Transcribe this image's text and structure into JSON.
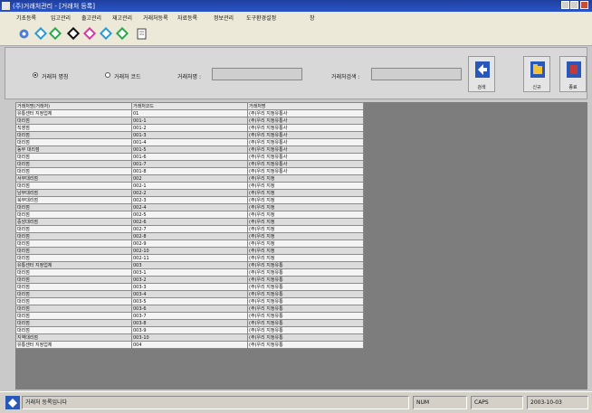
{
  "window": {
    "title": "(주)거래처관리 - [거래처 등록]",
    "controls": [
      "minimize-icon",
      "maximize-icon",
      "close-icon"
    ]
  },
  "menu": {
    "items": [
      "기초등록",
      "입고관리",
      "출고관리",
      "재고관리",
      "거래처등록",
      "자료등록",
      "정보관리",
      "도구환경설정",
      "창"
    ]
  },
  "toolbar": {
    "icons": [
      "app-icon",
      "nav-first-icon",
      "nav-prev-icon",
      "nav-stop-icon",
      "nav-refresh-icon",
      "nav-next-icon",
      "nav-last-icon",
      "document-icon"
    ]
  },
  "search_panel": {
    "radio_name": "거래처 명칭",
    "radio_code": "거래처 코드",
    "name_label": "거래처명 :",
    "name_value": "",
    "addr_label": "거래처검색 :",
    "addr_value": "",
    "btn_search": "검색",
    "btn_new": "신규",
    "btn_exit": "종료"
  },
  "grid": {
    "columns": [
      "거래처명(거래처)",
      "거래처코드",
      "거래처명"
    ],
    "rows": [
      [
        "유통센터 지정업체",
        "01",
        "(주)우리 지정유통사"
      ],
      [
        "대리점",
        "001-1",
        "(주)우리 지정유통사"
      ],
      [
        "직영점",
        "001-2",
        "(주)우리 지정유통사"
      ],
      [
        "대리점",
        "001-3",
        "(주)우리 지정유통사"
      ],
      [
        "대리점",
        "001-4",
        "(주)우리 지정유통사"
      ],
      [
        "동부 대리점",
        "001-5",
        "(주)우리 지정유통사"
      ],
      [
        "대리점",
        "001-6",
        "(주)우리 지정유통사"
      ],
      [
        "대리점",
        "001-7",
        "(주)우리 지정유통사"
      ],
      [
        "대리점",
        "001-8",
        "(주)우리 지정유통사"
      ],
      [
        "서부대리점",
        "002",
        "(주)우리 지정"
      ],
      [
        "대리점",
        "002-1",
        "(주)우리 지정"
      ],
      [
        "남부대리점",
        "002-2",
        "(주)우리 지정"
      ],
      [
        "북부대리점",
        "002-3",
        "(주)우리 지정"
      ],
      [
        "대리점",
        "002-4",
        "(주)우리 지정"
      ],
      [
        "대리점",
        "002-5",
        "(주)우리 지정"
      ],
      [
        "중앙대리점",
        "002-6",
        "(주)우리 지정"
      ],
      [
        "대리점",
        "002-7",
        "(주)우리 지정"
      ],
      [
        "대리점",
        "002-8",
        "(주)우리 지정"
      ],
      [
        "대리점",
        "002-9",
        "(주)우리 지정"
      ],
      [
        "대리점",
        "002-10",
        "(주)우리 지정"
      ],
      [
        "대리점",
        "002-11",
        "(주)우리 지정"
      ],
      [
        "유통센터 지정업체",
        "003",
        "(주)우리 지정유통"
      ],
      [
        "대리점",
        "003-1",
        "(주)우리 지정유통"
      ],
      [
        "대리점",
        "003-2",
        "(주)우리 지정유통"
      ],
      [
        "대리점",
        "003-3",
        "(주)우리 지정유통"
      ],
      [
        "대리점",
        "003-4",
        "(주)우리 지정유통"
      ],
      [
        "대리점",
        "003-5",
        "(주)우리 지정유통"
      ],
      [
        "대리점",
        "003-6",
        "(주)우리 지정유통"
      ],
      [
        "대리점",
        "003-7",
        "(주)우리 지정유통"
      ],
      [
        "대리점",
        "003-8",
        "(주)우리 지정유통"
      ],
      [
        "대리점",
        "003-9",
        "(주)우리 지정유통"
      ],
      [
        "지역대리점",
        "003-10",
        "(주)우리 지정유통"
      ],
      [
        "유통센터 지정업체",
        "004",
        "(주)우리 지정유통"
      ]
    ]
  },
  "status": {
    "message": "거래처 등록입니다",
    "num": "NUM",
    "caps": "CAPS",
    "date": "2003-10-03"
  }
}
